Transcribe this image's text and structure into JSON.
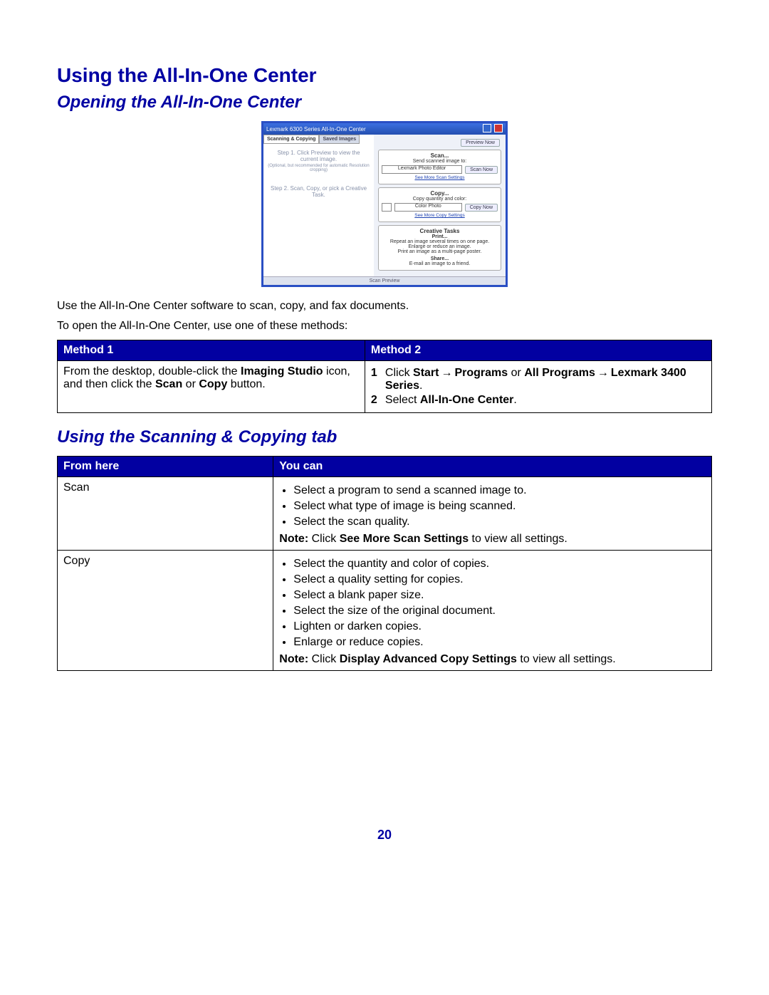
{
  "headings": {
    "h1": "Using the All-In-One Center",
    "h2a": "Opening the All-In-One Center",
    "h2b": "Using the Scanning & Copying tab"
  },
  "paragraphs": {
    "p1": "Use the All-In-One Center software to scan, copy, and fax documents.",
    "p2": "To open the All-In-One Center, use one of these methods:"
  },
  "screenshot": {
    "titlebar": "Lexmark 6300 Series All-In-One Center",
    "tab_active": "Scanning & Copying",
    "tab_inactive": "Saved Images",
    "step1": "Step 1. Click Preview to view the current image.",
    "step1_sub": "(Optional, but recommended for automatic Resolution cropping)",
    "step2": "Step 2. Scan, Copy, or pick a Creative Task.",
    "preview_btn": "Preview Now",
    "scan": {
      "label": "Scan...",
      "sub": "Send scanned image to:",
      "option": "Lexmark Photo Editor",
      "button": "Scan Now",
      "link": "See More Scan Settings"
    },
    "copy": {
      "label": "Copy...",
      "sub": "Copy quantity and color:",
      "option": "Color Photo",
      "button": "Copy Now",
      "link": "See More Copy Settings"
    },
    "creative": {
      "label": "Creative Tasks",
      "print": "Print...",
      "t1": "Repeat an image several times on one page.",
      "t2": "Enlarge or reduce an image.",
      "t3": "Print an image as a multi-page poster.",
      "share": "Share...",
      "t4": "E-mail an image to a friend."
    },
    "footer": "Scan Preview"
  },
  "methods_table": {
    "header1": "Method 1",
    "header2": "Method 2",
    "m1_pre": "From the desktop, double-click the ",
    "m1_bold": "Imaging Studio",
    "m1_mid": " icon, and then click the ",
    "m1_bold2": "Scan",
    "m1_or": " or ",
    "m1_bold3": "Copy",
    "m1_post": " button.",
    "m2_s1_click": "Click ",
    "m2_s1_start": "Start",
    "m2_s1_programs": "Programs",
    "m2_s1_or": " or ",
    "m2_s1_allprograms": "All Programs",
    "m2_s1_lex": "Lexmark 3400 Series",
    "m2_s1_period": ".",
    "m2_s2_pre": "Select ",
    "m2_s2_bold": "All-In-One Center",
    "m2_s2_post": "."
  },
  "scan_table": {
    "header1": "From here",
    "header2": "You can",
    "row1_label": "Scan",
    "row1_items": [
      "Select a program to send a scanned image to.",
      "Select what type of image is being scanned.",
      "Select the scan quality."
    ],
    "row1_note_pre": "Note: ",
    "row1_note_mid": "Click ",
    "row1_note_bold": "See More Scan Settings",
    "row1_note_post": " to view all settings.",
    "row2_label": "Copy",
    "row2_items": [
      "Select the quantity and color of copies.",
      "Select a quality setting for copies.",
      "Select a blank paper size.",
      "Select the size of the original document.",
      "Lighten or darken copies.",
      "Enlarge or reduce copies."
    ],
    "row2_note_pre": "Note: ",
    "row2_note_mid": "Click ",
    "row2_note_bold": "Display Advanced Copy Settings",
    "row2_note_post": " to view all settings."
  },
  "page_number": "20"
}
